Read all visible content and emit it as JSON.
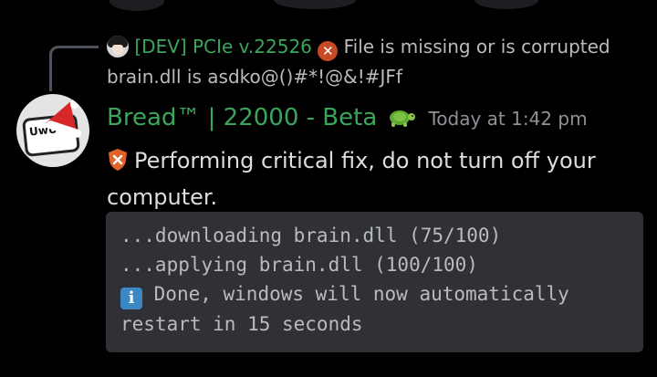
{
  "reply": {
    "author": "[DEV] PCIe v.22526",
    "preview": "File is missing or is corrupted",
    "preview_line2": "brain.dll is asdko@()#*!@&!#JFf"
  },
  "message": {
    "username": "Bread™ | 22000 - Beta",
    "timestamp": "Today at 1:42 pm",
    "text": "Performing critical fix, do not turn off your computer.",
    "code": {
      "line1": "...downloading brain.dll (75/100)",
      "line2": "...applying brain.dll (100/100)",
      "line3": "Done, windows will now automatically",
      "line4": "restart in 15 seconds"
    }
  },
  "avatar": {
    "label": "UwU"
  },
  "icons": {
    "reply_avatar": "user-avatar-icon",
    "error": "cross-mark-icon",
    "badge": "turtle-icon",
    "warning": "shield-icon",
    "info": "info-icon"
  },
  "colors": {
    "background": "#000000",
    "username": "#3ba55d",
    "code_bg": "#2f3136",
    "error_icon": "#c74a25",
    "info_icon": "#3b88c3"
  }
}
